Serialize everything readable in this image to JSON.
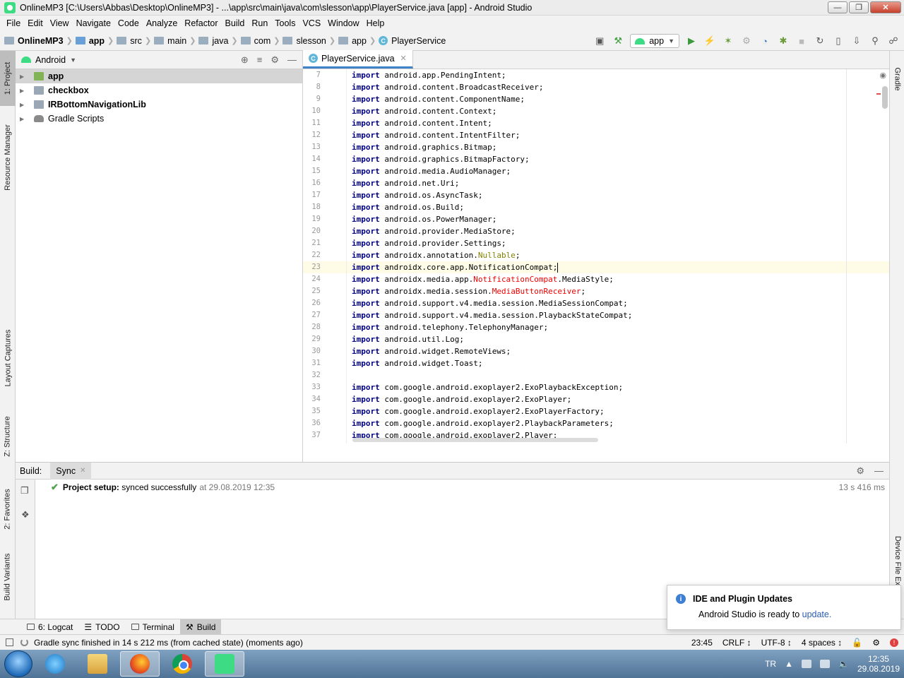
{
  "window": {
    "title": "OnlineMP3 [C:\\Users\\Abbas\\Desktop\\OnlineMP3] - ...\\app\\src\\main\\java\\com\\slesson\\app\\PlayerService.java [app] - Android Studio"
  },
  "menu": [
    "File",
    "Edit",
    "View",
    "Navigate",
    "Code",
    "Analyze",
    "Refactor",
    "Build",
    "Run",
    "Tools",
    "VCS",
    "Window",
    "Help"
  ],
  "breadcrumb": [
    "OnlineMP3",
    "app",
    "src",
    "main",
    "java",
    "com",
    "slesson",
    "app",
    "PlayerService"
  ],
  "toolbar": {
    "run_config": "app"
  },
  "left_tabs": [
    "1: Project",
    "Resource Manager",
    "Layout Captures",
    "Z: Structure",
    "2: Favorites",
    "Build Variants"
  ],
  "right_tabs": [
    "Gradle",
    "Device File Ex"
  ],
  "project": {
    "view": "Android",
    "items": [
      {
        "label": "app",
        "bold": true,
        "selected": true
      },
      {
        "label": "checkbox",
        "bold": true
      },
      {
        "label": "IRBottomNavigationLib",
        "bold": true
      },
      {
        "label": "Gradle Scripts",
        "bold": false
      }
    ]
  },
  "editor": {
    "tab": "PlayerService.java",
    "current_line": 23,
    "lines": [
      {
        "n": 7,
        "text": "import android.app.PendingIntent;"
      },
      {
        "n": 8,
        "text": "import android.content.BroadcastReceiver;"
      },
      {
        "n": 9,
        "text": "import android.content.ComponentName;"
      },
      {
        "n": 10,
        "text": "import android.content.Context;"
      },
      {
        "n": 11,
        "text": "import android.content.Intent;"
      },
      {
        "n": 12,
        "text": "import android.content.IntentFilter;"
      },
      {
        "n": 13,
        "text": "import android.graphics.Bitmap;"
      },
      {
        "n": 14,
        "text": "import android.graphics.BitmapFactory;"
      },
      {
        "n": 15,
        "text": "import android.media.AudioManager;"
      },
      {
        "n": 16,
        "text": "import android.net.Uri;"
      },
      {
        "n": 17,
        "text": "import android.os.AsyncTask;"
      },
      {
        "n": 18,
        "text": "import android.os.Build;"
      },
      {
        "n": 19,
        "text": "import android.os.PowerManager;"
      },
      {
        "n": 20,
        "text": "import android.provider.MediaStore;"
      },
      {
        "n": 21,
        "text": "import android.provider.Settings;"
      },
      {
        "n": 22,
        "text": "import androidx.annotation.Nullable;",
        "hl": "Nullable",
        "hl_class": "warn"
      },
      {
        "n": 23,
        "text": "import androidx.core.app.NotificationCompat;"
      },
      {
        "n": 24,
        "text": "import androidx.media.app.NotificationCompat.MediaStyle;",
        "hl": "NotificationCompat",
        "hl_class": "err"
      },
      {
        "n": 25,
        "text": "import androidx.media.session.MediaButtonReceiver;",
        "hl": "MediaButtonReceiver",
        "hl_class": "err"
      },
      {
        "n": 26,
        "text": "import android.support.v4.media.session.MediaSessionCompat;"
      },
      {
        "n": 27,
        "text": "import android.support.v4.media.session.PlaybackStateCompat;"
      },
      {
        "n": 28,
        "text": "import android.telephony.TelephonyManager;"
      },
      {
        "n": 29,
        "text": "import android.util.Log;"
      },
      {
        "n": 30,
        "text": "import android.widget.RemoteViews;"
      },
      {
        "n": 31,
        "text": "import android.widget.Toast;"
      },
      {
        "n": 32,
        "text": ""
      },
      {
        "n": 33,
        "text": "import com.google.android.exoplayer2.ExoPlaybackException;"
      },
      {
        "n": 34,
        "text": "import com.google.android.exoplayer2.ExoPlayer;"
      },
      {
        "n": 35,
        "text": "import com.google.android.exoplayer2.ExoPlayerFactory;"
      },
      {
        "n": 36,
        "text": "import com.google.android.exoplayer2.PlaybackParameters;"
      },
      {
        "n": 37,
        "text": "import com.google.android.exoplayer2.Player;"
      }
    ]
  },
  "build": {
    "label": "Build:",
    "tab": "Sync",
    "message_bold": "Project setup:",
    "message": "synced successfully",
    "timestamp": "at 29.08.2019 12:35",
    "duration": "13 s 416 ms"
  },
  "bottom_tabs": [
    "6: Logcat",
    "TODO",
    "Terminal",
    "Build"
  ],
  "status": {
    "message": "Gradle sync finished in 14 s 212 ms (from cached state) (moments ago)",
    "position": "23:45",
    "line_sep": "CRLF ↕",
    "encoding": "UTF-8 ↕",
    "indent": "4 spaces ↕"
  },
  "notification": {
    "title": "IDE and Plugin Updates",
    "text": "Android Studio is ready to",
    "link": "update."
  },
  "taskbar": {
    "lang": "TR",
    "time": "12:35",
    "date": "29.08.2019"
  }
}
